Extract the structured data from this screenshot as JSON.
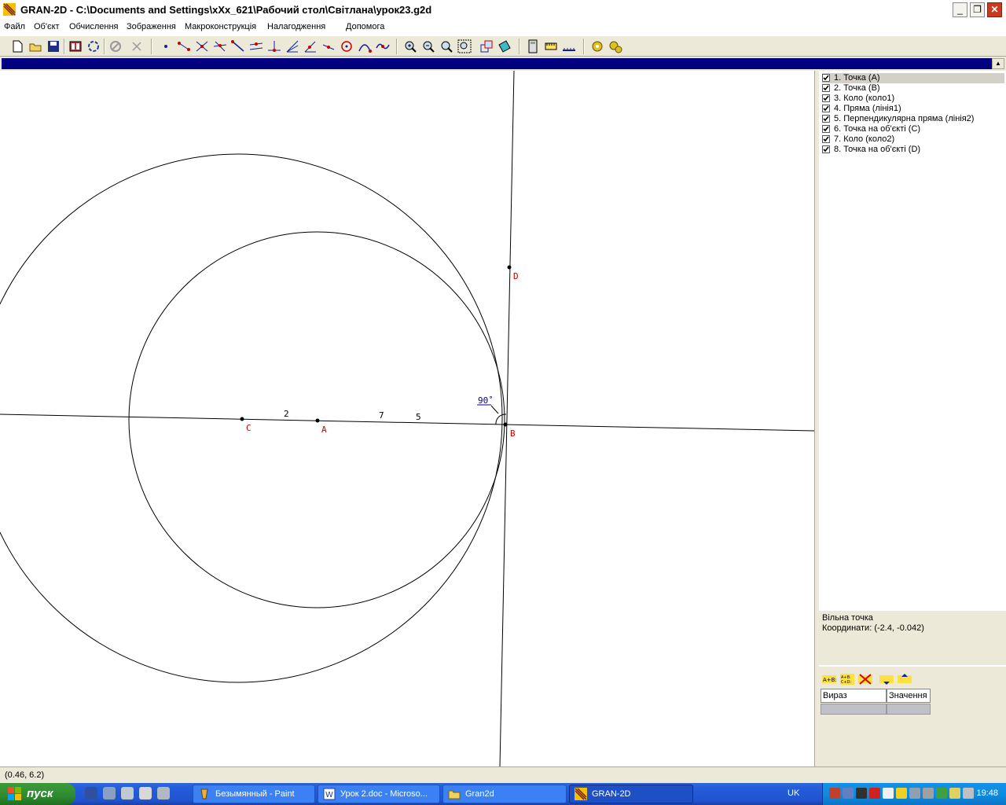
{
  "window": {
    "title": "GRAN-2D - C:\\Documents and Settings\\xXx_621\\Рабочий стол\\Світлана\\урок23.g2d",
    "minimize": "_",
    "restore": "❐",
    "close": "✕"
  },
  "menu": {
    "items": [
      "Файл",
      "Об'єкт",
      "Обчислення",
      "Зображення",
      "Макроконструкція",
      "Налагодження",
      "Допомога"
    ]
  },
  "toolbar": {
    "icons": [
      "new-file-icon",
      "open-folder-icon",
      "save-icon",
      "film-icon",
      "rotate-icon",
      "disabled-circle-icon",
      "scissors-icon",
      "point-icon",
      "segment-icon",
      "intersect-lines-icon",
      "cross-lines-icon",
      "ray-icon",
      "parallel-icon",
      "perpendicular-icon",
      "bisector-icon",
      "angle-icon",
      "arc-icon",
      "circle-icon",
      "curve-icon",
      "spline-icon",
      "zoom-in-icon",
      "zoom-out-icon",
      "zoom-fit-icon",
      "zoom-window-icon",
      "move-icon",
      "transform-icon",
      "calculator-icon",
      "measure-icon",
      "ruler-icon",
      "macro-icon",
      "gears-icon"
    ]
  },
  "drawing": {
    "labels": {
      "A": "A",
      "B": "B",
      "C": "C",
      "D": "D",
      "seg1": "2",
      "seg2": "7",
      "seg3": "5",
      "angle": "90˚"
    },
    "colors": {
      "point_label": "#cc0000",
      "line": "#000000",
      "angle_label": "#00008b"
    }
  },
  "objects": {
    "items": [
      {
        "checked": true,
        "label": "1. Точка (A)",
        "selected": true
      },
      {
        "checked": true,
        "label": "2. Точка (B)",
        "selected": false
      },
      {
        "checked": true,
        "label": "3. Коло (коло1)",
        "selected": false
      },
      {
        "checked": true,
        "label": "4. Пряма (лінія1)",
        "selected": false
      },
      {
        "checked": true,
        "label": "5. Перпендикулярна пряма (лінія2)",
        "selected": false
      },
      {
        "checked": true,
        "label": "6. Точка на об'єкті (C)",
        "selected": false
      },
      {
        "checked": true,
        "label": "7. Коло (коло2)",
        "selected": false
      },
      {
        "checked": true,
        "label": "8. Точка на об'єкті (D)",
        "selected": false
      }
    ]
  },
  "info": {
    "type": "Вільна точка",
    "coords": "Координати: (-2.4, -0.042)"
  },
  "calc": {
    "col_expr": "Вираз",
    "col_value": "Значення"
  },
  "status": {
    "coords": "(0.46, 6.2)"
  },
  "taskbar": {
    "start": "пуск",
    "tasks": [
      {
        "label": "Безымянный - Paint",
        "icon": "paint-icon",
        "active": false
      },
      {
        "label": "Урок 2.doc - Microso...",
        "icon": "word-icon",
        "active": false
      },
      {
        "label": "Gran2d",
        "icon": "folder-icon",
        "active": false
      },
      {
        "label": "GRAN-2D",
        "icon": "gran2d-icon",
        "active": true
      }
    ],
    "lang": "UK",
    "clock": "19:48"
  }
}
